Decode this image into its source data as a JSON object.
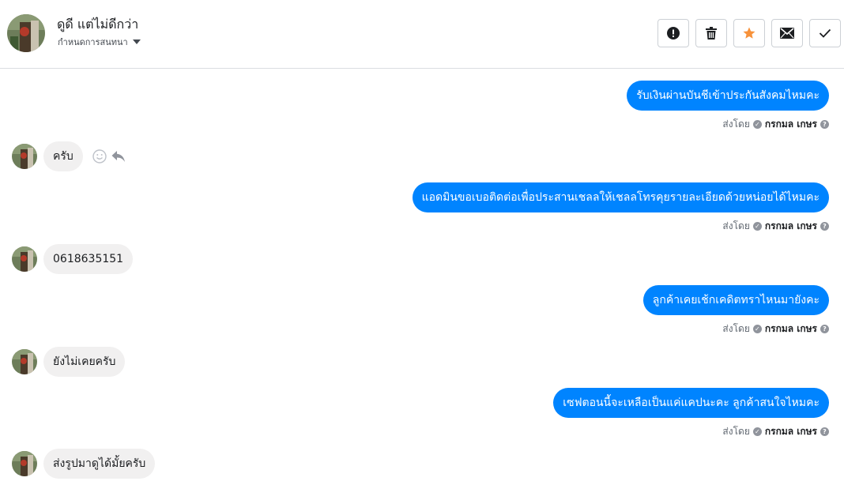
{
  "header": {
    "contact_name": "ดูดี แต่ไม่ดีกว่า",
    "assign_label": "กำหนดการสนทนา",
    "actions": [
      {
        "name": "mark-spam-button",
        "icon": "exclamation-circle-icon"
      },
      {
        "name": "delete-button",
        "icon": "trash-icon"
      },
      {
        "name": "star-button",
        "icon": "star-icon"
      },
      {
        "name": "mark-unread-button",
        "icon": "envelope-icon"
      },
      {
        "name": "mark-done-button",
        "icon": "checkmark-icon"
      }
    ],
    "star_color": "#f7923b"
  },
  "sent_by": {
    "prefix": "ส่งโดย",
    "name": "กรกมล เกษร"
  },
  "messages": [
    {
      "direction": "out",
      "text": "รับเงินผ่านบันชีเข้าประกันสังคมไหมคะ"
    },
    {
      "direction": "in",
      "text": "ครับ"
    },
    {
      "direction": "out",
      "text": "แอดมินขอเบอติดต่อเพื่อประสานเชลลให้เชลลโทรคุยรายละเอียดด้วยหน่อยได้ไหมคะ"
    },
    {
      "direction": "in",
      "text": "0618635151"
    },
    {
      "direction": "out",
      "text": "ลูกค้าเคยเช้กเคดิตทราไหนมายังคะ"
    },
    {
      "direction": "in",
      "text": "ยังไม่เคยครับ"
    },
    {
      "direction": "out",
      "text": "เซฟตอนนี้จะเหลือเป็นแค่แคปนะคะ  ลูกค้าสนใจไหมคะ"
    },
    {
      "direction": "in",
      "text": "ส่งรูปมาดูได้มั้ยครับ"
    }
  ],
  "colors": {
    "outgoing_bubble": "#0084ff",
    "incoming_bubble": "#f1f0f0"
  }
}
